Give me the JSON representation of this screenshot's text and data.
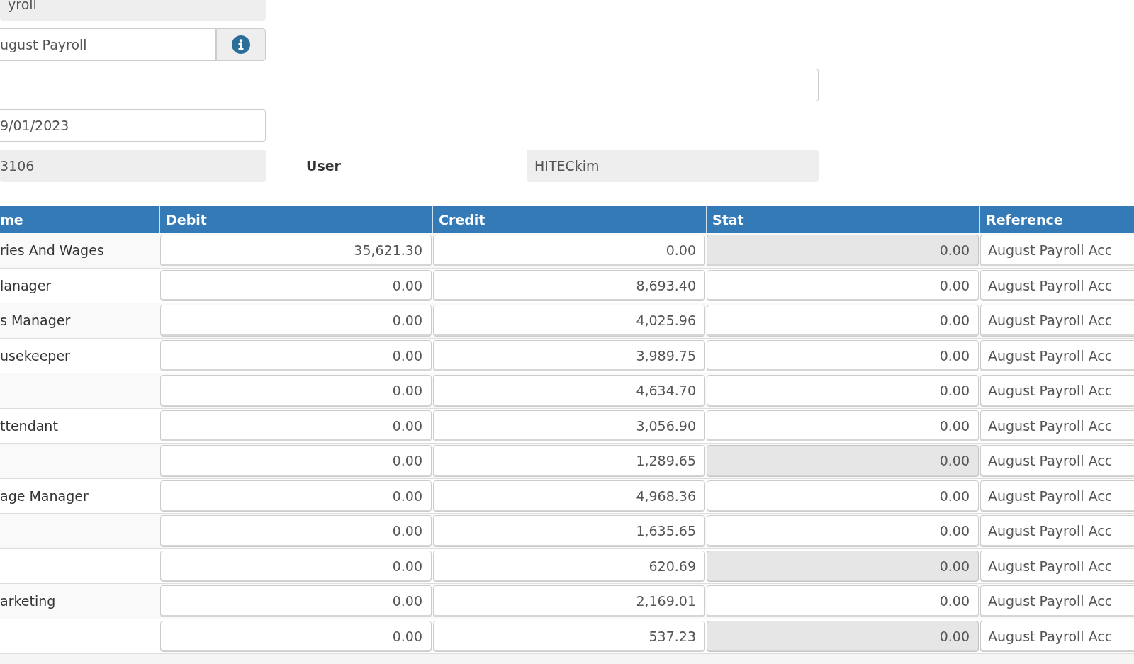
{
  "fields": [
    {
      "kind": "readonly",
      "value": "yroll"
    },
    {
      "kind": "lookup",
      "value": "ugust Payroll"
    },
    {
      "kind": "wide"
    },
    {
      "kind": "input",
      "value": "9/01/2023"
    }
  ],
  "id_row": {
    "value": "3106",
    "label": "User",
    "user_value": "HITECkim"
  },
  "table": {
    "columns": [
      {
        "label": "me"
      },
      {
        "label": "Debit"
      },
      {
        "label": "Credit"
      },
      {
        "label": "Stat"
      },
      {
        "label": "Reference"
      }
    ],
    "rows": [
      {
        "name": "ries And Wages",
        "debit": "35,621.30",
        "credit": "0.00",
        "stat": "0.00",
        "stat_disabled": true,
        "reference": "August Payroll Acc"
      },
      {
        "name": "lanager",
        "debit": "0.00",
        "credit": "8,693.40",
        "stat": "0.00",
        "stat_disabled": false,
        "reference": "August Payroll Acc"
      },
      {
        "name": "s Manager",
        "debit": "0.00",
        "credit": "4,025.96",
        "stat": "0.00",
        "stat_disabled": false,
        "reference": "August Payroll Acc"
      },
      {
        "name": "usekeeper",
        "debit": "0.00",
        "credit": "3,989.75",
        "stat": "0.00",
        "stat_disabled": false,
        "reference": "August Payroll Acc"
      },
      {
        "debit": "0.00",
        "credit": "4,634.70",
        "stat": "0.00",
        "stat_disabled": false,
        "reference": "August Payroll Acc"
      },
      {
        "name": "ttendant",
        "debit": "0.00",
        "credit": "3,056.90",
        "stat": "0.00",
        "stat_disabled": false,
        "reference": "August Payroll Acc"
      },
      {
        "debit": "0.00",
        "credit": "1,289.65",
        "stat": "0.00",
        "stat_disabled": true,
        "reference": "August Payroll Acc"
      },
      {
        "name": "age Manager",
        "debit": "0.00",
        "credit": "4,968.36",
        "stat": "0.00",
        "stat_disabled": false,
        "reference": "August Payroll Acc"
      },
      {
        "debit": "0.00",
        "credit": "1,635.65",
        "stat": "0.00",
        "stat_disabled": false,
        "reference": "August Payroll Acc"
      },
      {
        "debit": "0.00",
        "credit": "620.69",
        "stat": "0.00",
        "stat_disabled": true,
        "reference": "August Payroll Acc"
      },
      {
        "name": "arketing",
        "debit": "0.00",
        "credit": "2,169.01",
        "stat": "0.00",
        "stat_disabled": false,
        "reference": "August Payroll Acc"
      },
      {
        "debit": "0.00",
        "credit": "537.23",
        "stat": "0.00",
        "stat_disabled": true,
        "reference": "August Payroll Acc"
      }
    ]
  }
}
